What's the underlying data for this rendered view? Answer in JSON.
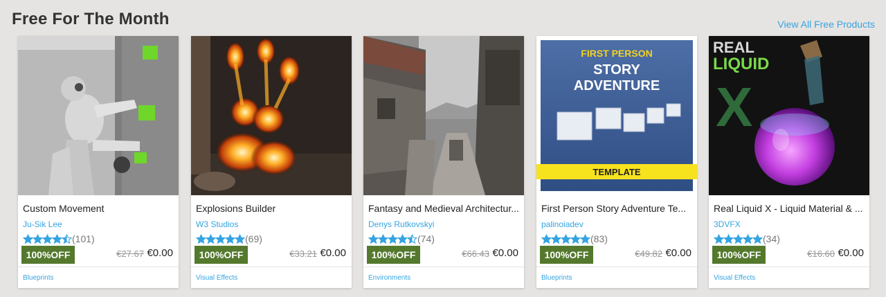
{
  "section": {
    "title": "Free For The Month",
    "view_all": "View All Free Products"
  },
  "colors": {
    "accent": "#35a4e0",
    "badge": "#54792d",
    "star": "#35a4e0",
    "background": "#e6e4e2"
  },
  "cards": [
    {
      "title": "Custom Movement",
      "seller": "Ju-Sik Lee",
      "rating": 4.5,
      "rating_count": "(101)",
      "discount": "100%OFF",
      "old_price": "€27.67",
      "new_price": "€0.00",
      "category": "Blueprints"
    },
    {
      "title": "Explosions Builder",
      "seller": "W3 Studios",
      "rating": 5,
      "rating_count": "(69)",
      "discount": "100%OFF",
      "old_price": "€33.21",
      "new_price": "€0.00",
      "category": "Visual Effects"
    },
    {
      "title": "Fantasy and Medieval Architectur...",
      "seller": "Denys Rutkovskyi",
      "rating": 4.5,
      "rating_count": "(74)",
      "discount": "100%OFF",
      "old_price": "€66.43",
      "new_price": "€0.00",
      "category": "Environments"
    },
    {
      "title": "First Person Story Adventure Te...",
      "seller": "palinoiadev",
      "rating": 5,
      "rating_count": "(83)",
      "discount": "100%OFF",
      "old_price": "€49.82",
      "new_price": "€0.00",
      "category": "Blueprints",
      "thumb_text": {
        "line1": "FIRST PERSON",
        "line2": "STORY",
        "line3": "ADVENTURE",
        "banner": "TEMPLATE"
      }
    },
    {
      "title": "Real Liquid X - Liquid Material & ...",
      "seller": "3DVFX",
      "rating": 5,
      "rating_count": "(34)",
      "discount": "100%OFF",
      "old_price": "€16.60",
      "new_price": "€0.00",
      "category": "Visual Effects",
      "thumb_text": {
        "line1": "REAL",
        "line2": "LIQUID",
        "line3": "X"
      }
    }
  ]
}
